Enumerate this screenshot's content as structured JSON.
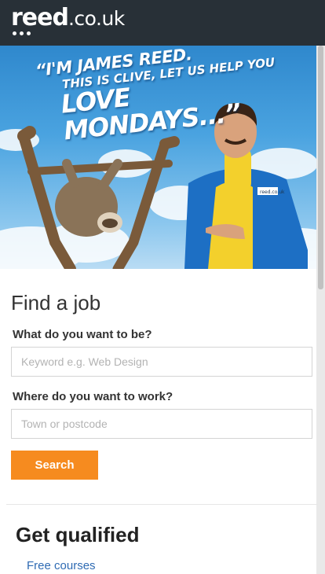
{
  "header": {
    "logo_main": "reed",
    "logo_suffix": ".co.uk"
  },
  "hero": {
    "slogan_line1": "“I'M JAMES REED.",
    "slogan_line2": "THIS IS CLIVE, LET US HELP YOU",
    "slogan_line3": "LOVE MONDAYS...”",
    "badge_text": "reed.co.uk"
  },
  "find_job": {
    "title": "Find a job",
    "what_label": "What do you want to be?",
    "what_placeholder": "Keyword e.g. Web Design",
    "where_label": "Where do you want to work?",
    "where_placeholder": "Town or postcode",
    "search_label": "Search"
  },
  "qualified": {
    "title": "Get qualified",
    "link_label": "Free courses"
  },
  "colors": {
    "header_bg": "#283037",
    "accent_orange": "#f68b1f",
    "link_blue": "#2f6bb3"
  }
}
